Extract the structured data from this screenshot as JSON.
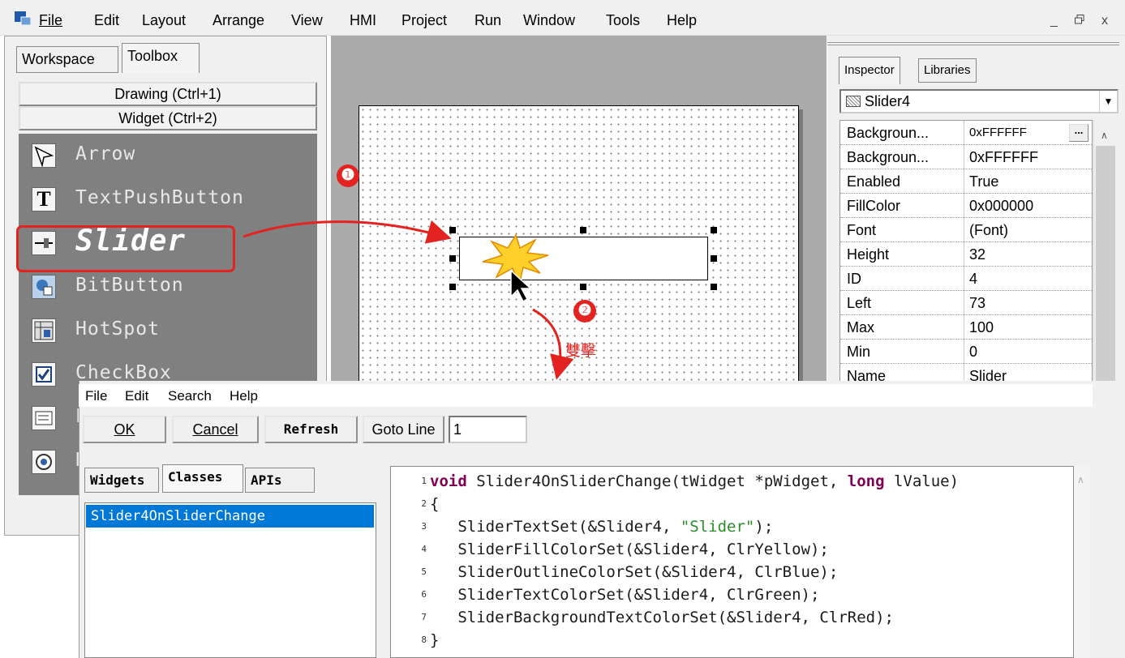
{
  "menubar": {
    "items": [
      "File",
      "Edit",
      "Layout",
      "Arrange",
      "View",
      "HMI",
      "Project",
      "Run",
      "Window",
      "Tools",
      "Help"
    ],
    "window_controls": {
      "minimize": "_",
      "restore": "ꟸ",
      "close": "x"
    }
  },
  "left_panel": {
    "tabs": [
      "Workspace",
      "Toolbox"
    ],
    "active_tab": "Toolbox",
    "categories": [
      "Drawing (Ctrl+1)",
      "Widget (Ctrl+2)"
    ],
    "tools": [
      "Arrow",
      "TextPushButton",
      "Slider",
      "BitButton",
      "HotSpot",
      "CheckBox",
      "L",
      "R"
    ],
    "selected_tool": "Slider"
  },
  "right_panel": {
    "tabs": [
      "Inspector",
      "Libraries"
    ],
    "active_tab": "Inspector",
    "selected_object": "Slider4",
    "properties": [
      {
        "name": "Backgroun...",
        "value": "0xFFFFFF"
      },
      {
        "name": "Backgroun...",
        "value": "0xFFFFFF"
      },
      {
        "name": "Enabled",
        "value": "True"
      },
      {
        "name": "FillColor",
        "value": "0x000000"
      },
      {
        "name": "Font",
        "value": "(Font)"
      },
      {
        "name": "Height",
        "value": "32"
      },
      {
        "name": "ID",
        "value": "4"
      },
      {
        "name": "Left",
        "value": "73"
      },
      {
        "name": "Max",
        "value": "100"
      },
      {
        "name": "Min",
        "value": "0"
      },
      {
        "name": "Name",
        "value": "Slider"
      }
    ],
    "ellipsis_label": "..."
  },
  "editor": {
    "menu": [
      "File",
      "Edit",
      "Search",
      "Help"
    ],
    "buttons": {
      "ok": "OK",
      "cancel": "Cancel",
      "refresh": "Refresh",
      "goto_line": "Goto Line"
    },
    "goto_line_value": "1",
    "tabs": [
      "Widgets",
      "Classes",
      "APIs"
    ],
    "active_tab": "Classes",
    "class_list": [
      "Slider4OnSliderChange"
    ],
    "code_lines": [
      {
        "n": "1",
        "segments": [
          {
            "t": "void",
            "k": "kw"
          },
          {
            "t": " Slider4OnSliderChange(tWidget *pWidget, ",
            "k": ""
          },
          {
            "t": "long",
            "k": "kw"
          },
          {
            "t": " lValue)",
            "k": ""
          }
        ]
      },
      {
        "n": "2",
        "segments": [
          {
            "t": "{",
            "k": ""
          }
        ]
      },
      {
        "n": "3",
        "segments": [
          {
            "t": "   SliderTextSet(&Slider4, ",
            "k": ""
          },
          {
            "t": "\"Slider\"",
            "k": "str"
          },
          {
            "t": ");",
            "k": ""
          }
        ]
      },
      {
        "n": "4",
        "segments": [
          {
            "t": "   SliderFillColorSet(&Slider4, ClrYellow);",
            "k": ""
          }
        ]
      },
      {
        "n": "5",
        "segments": [
          {
            "t": "   SliderOutlineColorSet(&Slider4, ClrBlue);",
            "k": ""
          }
        ]
      },
      {
        "n": "6",
        "segments": [
          {
            "t": "   SliderTextColorSet(&Slider4, ClrGreen);",
            "k": ""
          }
        ]
      },
      {
        "n": "7",
        "segments": [
          {
            "t": "   SliderBackgroundTextColorSet(&Slider4, ClrRed);",
            "k": ""
          }
        ]
      },
      {
        "n": "8",
        "segments": [
          {
            "t": "}",
            "k": ""
          }
        ]
      }
    ]
  },
  "annotations": {
    "step1": "❶",
    "step2": "❷",
    "double_click_label": "雙擊",
    "accent_color": "#e32320"
  },
  "colors": {
    "selection": "#0078d7",
    "toolbox_bg": "#808080",
    "workarea_bg": "#ababab"
  }
}
